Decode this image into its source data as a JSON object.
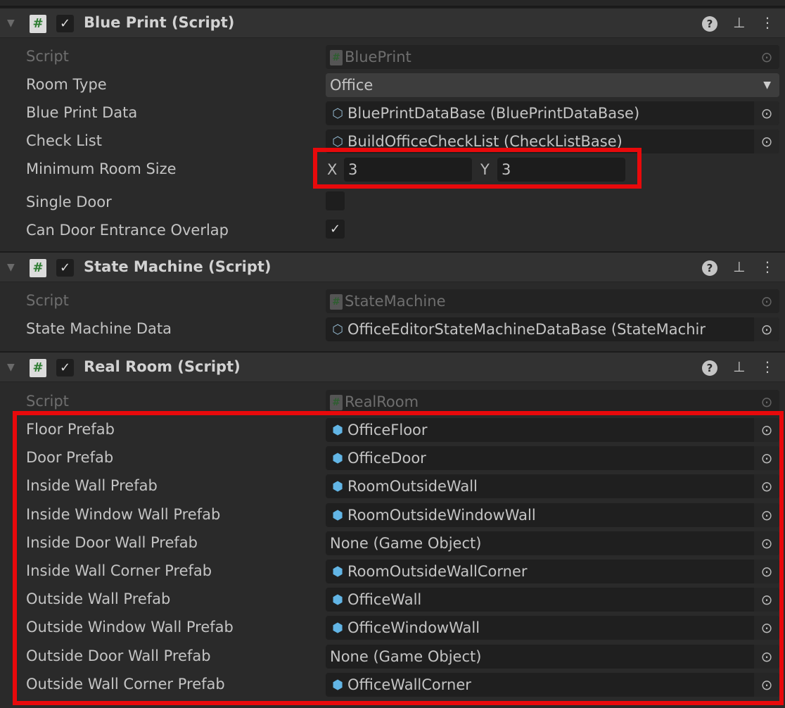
{
  "components": [
    {
      "title": "Blue Print (Script)",
      "enabled": true,
      "script": {
        "label": "Script",
        "value": "BluePrint"
      },
      "room_type": {
        "label": "Room Type",
        "value": "Office"
      },
      "blue_print_data": {
        "label": "Blue Print Data",
        "value": "BluePrintDataBase (BluePrintDataBase)"
      },
      "check_list": {
        "label": "Check List",
        "value": "BuildOfficeCheckList (CheckListBase)"
      },
      "min_room_size": {
        "label": "Minimum Room Size",
        "x_label": "X",
        "x": "3",
        "y_label": "Y",
        "y": "3"
      },
      "single_door": {
        "label": "Single Door",
        "checked": false
      },
      "can_door_overlap": {
        "label": "Can Door Entrance Overlap",
        "checked": true,
        "check": "✓"
      }
    },
    {
      "title": "State Machine (Script)",
      "enabled": true,
      "script": {
        "label": "Script",
        "value": "StateMachine"
      },
      "state_machine_data": {
        "label": "State Machine Data",
        "value": "OfficeEditorStateMachineDataBase (StateMachir"
      }
    },
    {
      "title": "Real Room (Script)",
      "enabled": true,
      "script": {
        "label": "Script",
        "value": "RealRoom"
      },
      "prefabs": [
        {
          "label": "Floor Prefab",
          "value": "OfficeFloor",
          "icon": "prefab-cube-icon"
        },
        {
          "label": "Door Prefab",
          "value": "OfficeDoor",
          "icon": "prefab-cube-icon"
        },
        {
          "label": "Inside Wall Prefab",
          "value": "RoomOutsideWall",
          "icon": "prefab-cube-icon"
        },
        {
          "label": "Inside Window Wall Prefab",
          "value": "RoomOutsideWindowWall",
          "icon": "prefab-cube-icon"
        },
        {
          "label": "Inside Door Wall Prefab",
          "value": "None (Game Object)",
          "icon": ""
        },
        {
          "label": "Inside Wall Corner Prefab",
          "value": "RoomOutsideWallCorner",
          "icon": "prefab-cube-icon"
        },
        {
          "label": "Outside Wall Prefab",
          "value": "OfficeWall",
          "icon": "prefab-cube-icon"
        },
        {
          "label": "Outside Window Wall Prefab",
          "value": "OfficeWindowWall",
          "icon": "prefab-cube-icon"
        },
        {
          "label": "Outside Door Wall Prefab",
          "value": "None (Game Object)",
          "icon": ""
        },
        {
          "label": "Outside Wall Corner Prefab",
          "value": "OfficeWallCorner",
          "icon": "prefab-cube-icon"
        }
      ]
    }
  ],
  "icons": {
    "script": "#",
    "check": "✓",
    "help": "?",
    "presets": "⊥",
    "menu": "⋮",
    "picker": "⊙",
    "fold": "▼",
    "dropdown": "▼",
    "prefab": "⬢",
    "scriptable": "⬡"
  },
  "colors": {
    "highlight": "#e8090b",
    "prefab": "#62b5e5",
    "script_hash": "#2e7d32"
  }
}
